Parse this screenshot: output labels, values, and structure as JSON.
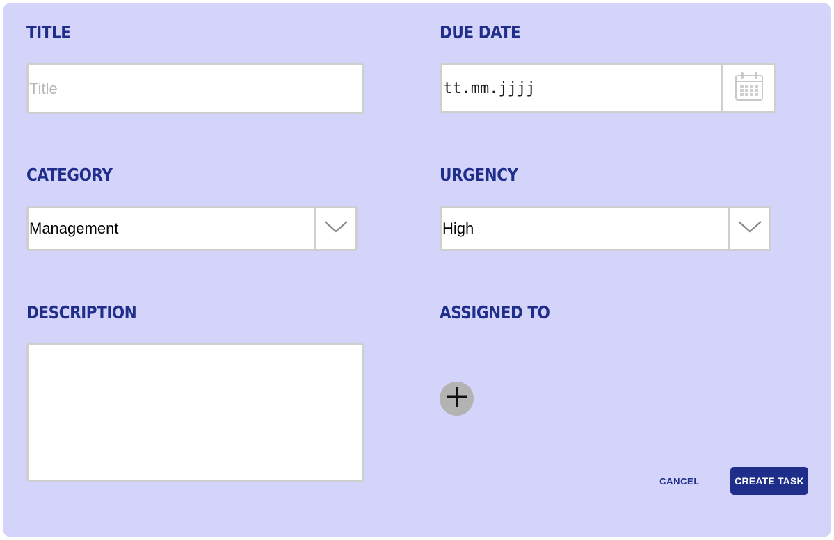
{
  "form": {
    "title": {
      "label": "TITLE",
      "value": "",
      "placeholder": "Title"
    },
    "due_date": {
      "label": "DUE DATE",
      "value": "tt.mm.jjjj",
      "icon": "calendar-icon"
    },
    "category": {
      "label": "CATEGORY",
      "selected": "Management",
      "icon": "chevron-down-icon"
    },
    "urgency": {
      "label": "URGENCY",
      "selected": "High",
      "icon": "chevron-down-icon"
    },
    "description": {
      "label": "DESCRIPTION",
      "value": ""
    },
    "assigned_to": {
      "label": "ASSIGNED TO",
      "add_icon": "plus-icon"
    }
  },
  "actions": {
    "cancel_label": "CANCEL",
    "create_label": "CREATE TASK"
  },
  "colors": {
    "panel_background": "#d4d3fa",
    "label_text": "#1f2e8a",
    "primary_button": "#1f2e8a",
    "add_button": "#b3b3b3",
    "field_border": "#cfcfcf"
  }
}
